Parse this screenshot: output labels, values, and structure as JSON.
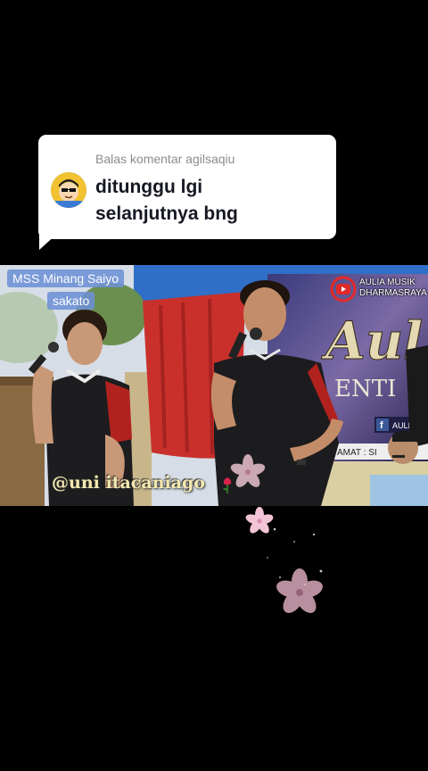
{
  "reply_card": {
    "header": "Balas komentar agilsaqiu",
    "comment_lines": [
      "ditunggu lgi",
      "selanjutnya bng"
    ]
  },
  "video": {
    "caption_line1": "MSS Minang Saiyo",
    "caption_line2": "sakato",
    "watermark_line1": "AULIA MUSIK",
    "watermark_line2": "DHARMASRAYA",
    "handle": "@uni itacaniago",
    "banner_fragments": [
      "ENTI",
      "AMAT : SI",
      "AULI"
    ]
  },
  "colors": {
    "background": "#000000",
    "bubble": "#ffffff",
    "header_text": "#8a8b91",
    "comment_text": "#161823",
    "caption_chip": "#6d91d6",
    "flower": "#f3c3d6"
  }
}
